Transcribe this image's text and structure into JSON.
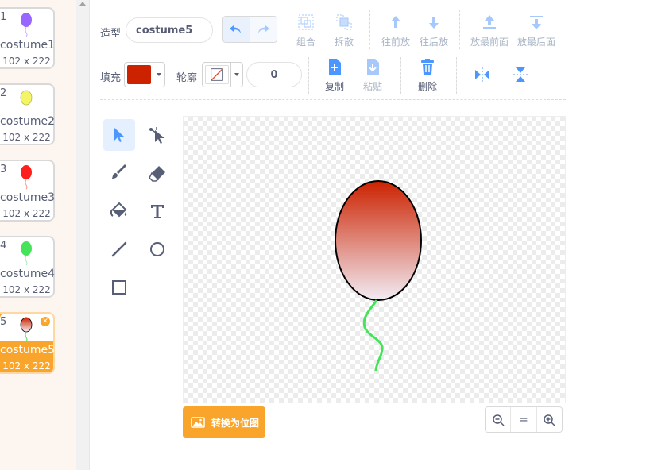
{
  "costumes": [
    {
      "num": "1",
      "name": "costume1",
      "size": "102 x 222",
      "color": "#9966ff"
    },
    {
      "num": "2",
      "name": "costume2",
      "size": "102 x 222",
      "color": "#f3f566"
    },
    {
      "num": "3",
      "name": "costume3",
      "size": "102 x 222",
      "color": "#ff1f1f"
    },
    {
      "num": "4",
      "name": "costume4",
      "size": "102 x 222",
      "color": "#44e35a"
    },
    {
      "num": "5",
      "name": "costume5",
      "size": "102 x 222",
      "color": "#cc2200",
      "selected": true
    }
  ],
  "toolbar": {
    "costume_label": "造型",
    "costume_name": "costume5",
    "group": "组合",
    "ungroup": "拆散",
    "forward": "往前放",
    "backward": "往后放",
    "front": "放最前面",
    "back": "放最后面",
    "fill_label": "填充",
    "outline_label": "轮廓",
    "outline_width": "0",
    "copy": "复制",
    "paste": "粘贴",
    "delete": "删除"
  },
  "colors": {
    "fill": "#cc2200",
    "accent": "#4c97ff",
    "orange": "#f9a42a",
    "text": "#575e75"
  },
  "canvas": {
    "convert_button": "转换为位图",
    "zoom_out": "−",
    "zoom_reset": "=",
    "zoom_in": "+"
  }
}
